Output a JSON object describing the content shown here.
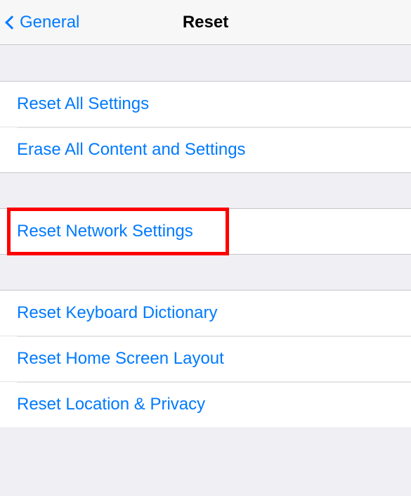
{
  "header": {
    "back_label": "General",
    "title": "Reset"
  },
  "groups": [
    {
      "items": [
        {
          "label": "Reset All Settings"
        },
        {
          "label": "Erase All Content and Settings"
        }
      ]
    },
    {
      "items": [
        {
          "label": "Reset Network Settings",
          "highlighted": true
        }
      ]
    },
    {
      "items": [
        {
          "label": "Reset Keyboard Dictionary"
        },
        {
          "label": "Reset Home Screen Layout"
        },
        {
          "label": "Reset Location & Privacy"
        }
      ]
    }
  ],
  "colors": {
    "link": "#007aff",
    "highlight": "#ff0000",
    "background": "#efeff4"
  }
}
